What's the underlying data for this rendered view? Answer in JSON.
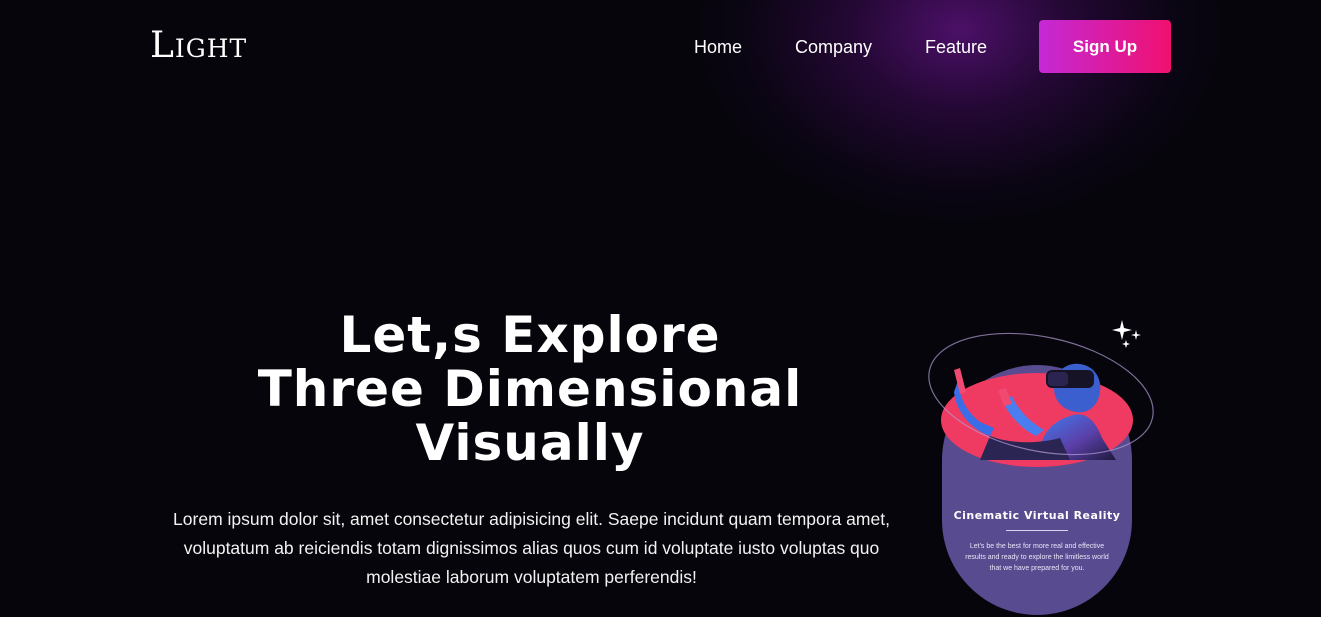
{
  "brand": {
    "logo": "Light"
  },
  "nav": {
    "items": [
      {
        "label": "Home"
      },
      {
        "label": "Company"
      },
      {
        "label": "Feature"
      }
    ],
    "signup_label": "Sign Up"
  },
  "hero": {
    "title_lines": [
      "Let,s Explore",
      "Three Dimensional",
      "Visually"
    ],
    "paragraph": "Lorem ipsum dolor sit, amet consectetur adipisicing elit. Saepe incidunt quam tempora amet, voluptatum ab reiciendis totam dignissimos alias quos cum id voluptate iusto voluptas quo molestiae laborum voluptatem perferendis!"
  },
  "card": {
    "title": "Cinematic Virtual Reality",
    "description": "Let's be the best for more real and effective results and ready to explore the limitless world that we have prepared for you."
  },
  "colors": {
    "background": "#05050b",
    "glow": "#581278",
    "button_start": "#c429d6",
    "button_end": "#f0106f",
    "card": "#584b8f",
    "accent_pink": "#f0345f"
  },
  "icons": {
    "sparkle": "sparkle-icon"
  }
}
